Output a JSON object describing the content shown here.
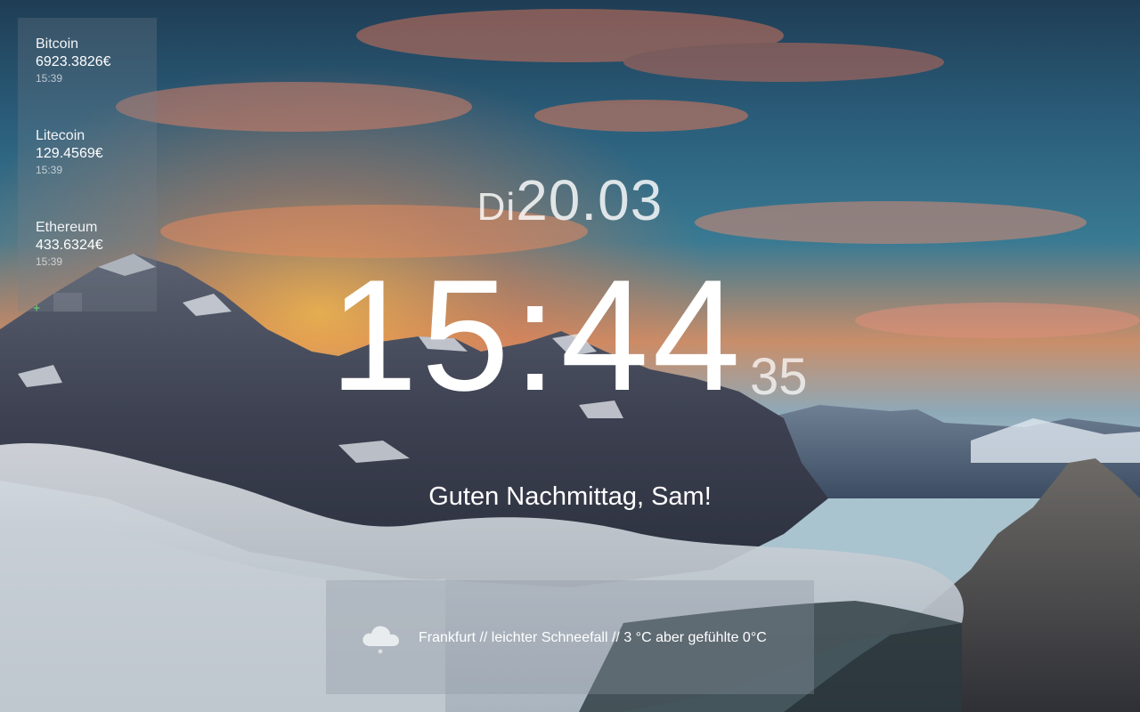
{
  "crypto": {
    "coins": [
      {
        "name": "Bitcoin",
        "price": "6923.3826€",
        "time": "15:39"
      },
      {
        "name": "Litecoin",
        "price": "129.4569€",
        "time": "15:39"
      },
      {
        "name": "Ethereum",
        "price": "433.6324€",
        "time": "15:39"
      }
    ],
    "add_label": "+"
  },
  "date": {
    "weekday": "Di",
    "date": "20.03"
  },
  "clock": {
    "hours_minutes": "15:44",
    "seconds": "35"
  },
  "greeting": "Guten Nachmittag, Sam!",
  "weather": {
    "text": "Frankfurt // leichter Schneefall // 3 °C aber gefühlte 0°C",
    "icon": "snow-cloud-icon"
  }
}
